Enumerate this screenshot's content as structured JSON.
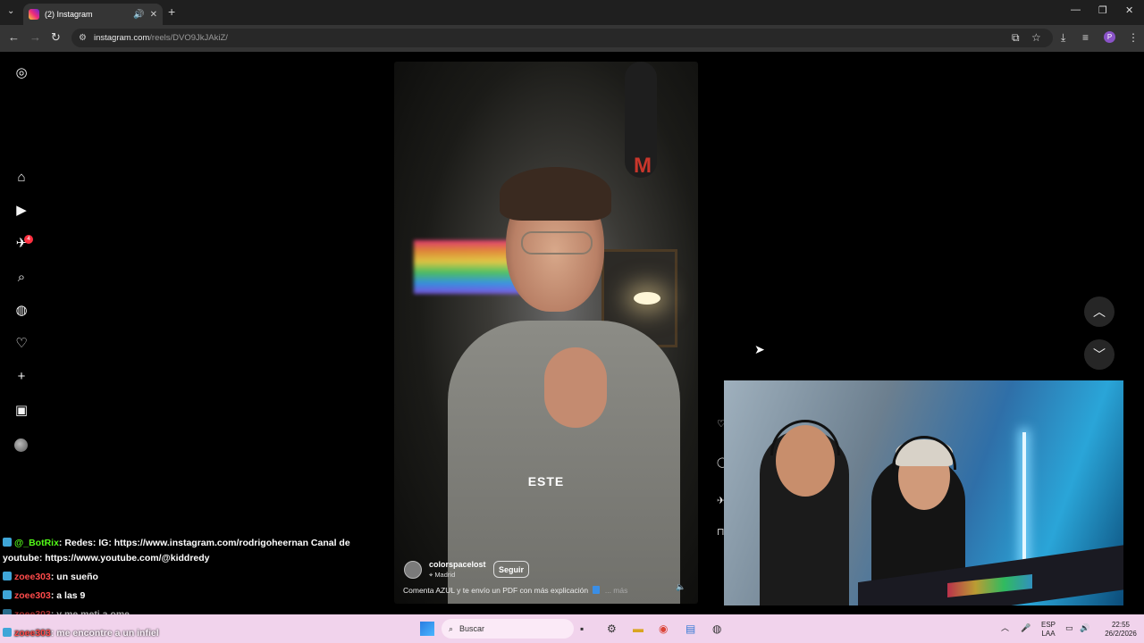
{
  "browser": {
    "tab_title": "(2) Instagram",
    "url_domain": "instagram.com",
    "url_path": "/reels/DVO9JkJAkiZ/",
    "profile_letter": "P"
  },
  "sidebar": {
    "notification_count": "4"
  },
  "reel": {
    "overlay_word": "ESTE",
    "username": "colorspacelost",
    "location": "Madrid",
    "follow_label": "Seguir",
    "description": "Comenta AZUL y te envío un PDF con más explicación",
    "more_label": "... más"
  },
  "chat": [
    {
      "user": "@_BotRix",
      "text": ": Redes: IG: https://www.instagram.com/rodrigoheernan Canal de",
      "continuation": "youtube: https://www.youtube.com/@kiddredy"
    },
    {
      "user": "zoee303",
      "text": ": un sueño"
    },
    {
      "user": "zoee303",
      "text": ": a las 9"
    },
    {
      "user": "zoee303",
      "text": ": y me meti a ome"
    },
    {
      "user": "zoee303",
      "text": ": me encontre a un infiel"
    }
  ],
  "taskbar": {
    "search_placeholder": "Buscar",
    "lang_top": "ESP",
    "lang_bottom": "LAA",
    "time": "22:55",
    "date": "26/2/2026"
  },
  "colors": {
    "accent": "#ff3040",
    "chat_bot": "#53fc18",
    "chat_user": "#ff4b4b",
    "taskbar_bg": "#f1d3ec"
  }
}
